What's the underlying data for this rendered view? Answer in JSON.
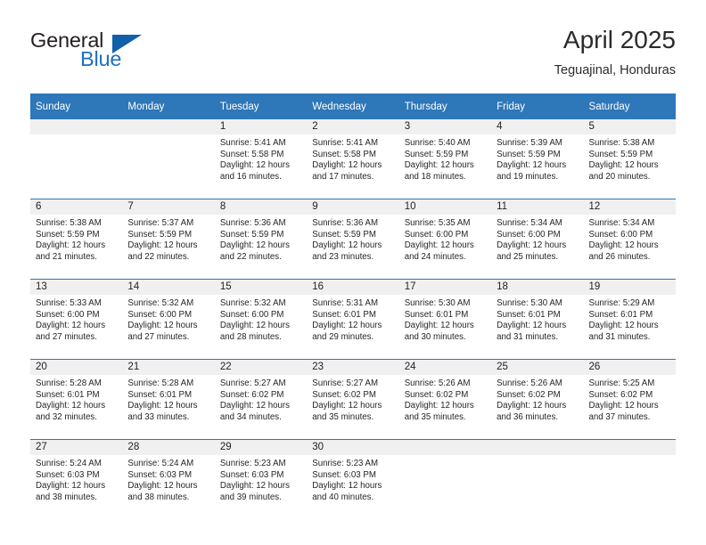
{
  "logo": {
    "word_one": "General",
    "word_two": "Blue",
    "triangle_icon": "triangle-icon"
  },
  "header": {
    "title": "April 2025",
    "location": "Teguajinal, Honduras"
  },
  "theme": {
    "header_blue": "#2e77b8",
    "band_gray": "#f0f0f0",
    "logo_blue": "#1f6ec4",
    "text": "#262626"
  },
  "weekdays": [
    "Sunday",
    "Monday",
    "Tuesday",
    "Wednesday",
    "Thursday",
    "Friday",
    "Saturday"
  ],
  "weeks": [
    [
      {
        "day": ""
      },
      {
        "day": ""
      },
      {
        "day": "1",
        "sunrise": "Sunrise: 5:41 AM",
        "sunset": "Sunset: 5:58 PM",
        "daylight1": "Daylight: 12 hours",
        "daylight2": "and 16 minutes."
      },
      {
        "day": "2",
        "sunrise": "Sunrise: 5:41 AM",
        "sunset": "Sunset: 5:58 PM",
        "daylight1": "Daylight: 12 hours",
        "daylight2": "and 17 minutes."
      },
      {
        "day": "3",
        "sunrise": "Sunrise: 5:40 AM",
        "sunset": "Sunset: 5:59 PM",
        "daylight1": "Daylight: 12 hours",
        "daylight2": "and 18 minutes."
      },
      {
        "day": "4",
        "sunrise": "Sunrise: 5:39 AM",
        "sunset": "Sunset: 5:59 PM",
        "daylight1": "Daylight: 12 hours",
        "daylight2": "and 19 minutes."
      },
      {
        "day": "5",
        "sunrise": "Sunrise: 5:38 AM",
        "sunset": "Sunset: 5:59 PM",
        "daylight1": "Daylight: 12 hours",
        "daylight2": "and 20 minutes."
      }
    ],
    [
      {
        "day": "6",
        "sunrise": "Sunrise: 5:38 AM",
        "sunset": "Sunset: 5:59 PM",
        "daylight1": "Daylight: 12 hours",
        "daylight2": "and 21 minutes."
      },
      {
        "day": "7",
        "sunrise": "Sunrise: 5:37 AM",
        "sunset": "Sunset: 5:59 PM",
        "daylight1": "Daylight: 12 hours",
        "daylight2": "and 22 minutes."
      },
      {
        "day": "8",
        "sunrise": "Sunrise: 5:36 AM",
        "sunset": "Sunset: 5:59 PM",
        "daylight1": "Daylight: 12 hours",
        "daylight2": "and 22 minutes."
      },
      {
        "day": "9",
        "sunrise": "Sunrise: 5:36 AM",
        "sunset": "Sunset: 5:59 PM",
        "daylight1": "Daylight: 12 hours",
        "daylight2": "and 23 minutes."
      },
      {
        "day": "10",
        "sunrise": "Sunrise: 5:35 AM",
        "sunset": "Sunset: 6:00 PM",
        "daylight1": "Daylight: 12 hours",
        "daylight2": "and 24 minutes."
      },
      {
        "day": "11",
        "sunrise": "Sunrise: 5:34 AM",
        "sunset": "Sunset: 6:00 PM",
        "daylight1": "Daylight: 12 hours",
        "daylight2": "and 25 minutes."
      },
      {
        "day": "12",
        "sunrise": "Sunrise: 5:34 AM",
        "sunset": "Sunset: 6:00 PM",
        "daylight1": "Daylight: 12 hours",
        "daylight2": "and 26 minutes."
      }
    ],
    [
      {
        "day": "13",
        "sunrise": "Sunrise: 5:33 AM",
        "sunset": "Sunset: 6:00 PM",
        "daylight1": "Daylight: 12 hours",
        "daylight2": "and 27 minutes."
      },
      {
        "day": "14",
        "sunrise": "Sunrise: 5:32 AM",
        "sunset": "Sunset: 6:00 PM",
        "daylight1": "Daylight: 12 hours",
        "daylight2": "and 27 minutes."
      },
      {
        "day": "15",
        "sunrise": "Sunrise: 5:32 AM",
        "sunset": "Sunset: 6:00 PM",
        "daylight1": "Daylight: 12 hours",
        "daylight2": "and 28 minutes."
      },
      {
        "day": "16",
        "sunrise": "Sunrise: 5:31 AM",
        "sunset": "Sunset: 6:01 PM",
        "daylight1": "Daylight: 12 hours",
        "daylight2": "and 29 minutes."
      },
      {
        "day": "17",
        "sunrise": "Sunrise: 5:30 AM",
        "sunset": "Sunset: 6:01 PM",
        "daylight1": "Daylight: 12 hours",
        "daylight2": "and 30 minutes."
      },
      {
        "day": "18",
        "sunrise": "Sunrise: 5:30 AM",
        "sunset": "Sunset: 6:01 PM",
        "daylight1": "Daylight: 12 hours",
        "daylight2": "and 31 minutes."
      },
      {
        "day": "19",
        "sunrise": "Sunrise: 5:29 AM",
        "sunset": "Sunset: 6:01 PM",
        "daylight1": "Daylight: 12 hours",
        "daylight2": "and 31 minutes."
      }
    ],
    [
      {
        "day": "20",
        "sunrise": "Sunrise: 5:28 AM",
        "sunset": "Sunset: 6:01 PM",
        "daylight1": "Daylight: 12 hours",
        "daylight2": "and 32 minutes."
      },
      {
        "day": "21",
        "sunrise": "Sunrise: 5:28 AM",
        "sunset": "Sunset: 6:01 PM",
        "daylight1": "Daylight: 12 hours",
        "daylight2": "and 33 minutes."
      },
      {
        "day": "22",
        "sunrise": "Sunrise: 5:27 AM",
        "sunset": "Sunset: 6:02 PM",
        "daylight1": "Daylight: 12 hours",
        "daylight2": "and 34 minutes."
      },
      {
        "day": "23",
        "sunrise": "Sunrise: 5:27 AM",
        "sunset": "Sunset: 6:02 PM",
        "daylight1": "Daylight: 12 hours",
        "daylight2": "and 35 minutes."
      },
      {
        "day": "24",
        "sunrise": "Sunrise: 5:26 AM",
        "sunset": "Sunset: 6:02 PM",
        "daylight1": "Daylight: 12 hours",
        "daylight2": "and 35 minutes."
      },
      {
        "day": "25",
        "sunrise": "Sunrise: 5:26 AM",
        "sunset": "Sunset: 6:02 PM",
        "daylight1": "Daylight: 12 hours",
        "daylight2": "and 36 minutes."
      },
      {
        "day": "26",
        "sunrise": "Sunrise: 5:25 AM",
        "sunset": "Sunset: 6:02 PM",
        "daylight1": "Daylight: 12 hours",
        "daylight2": "and 37 minutes."
      }
    ],
    [
      {
        "day": "27",
        "sunrise": "Sunrise: 5:24 AM",
        "sunset": "Sunset: 6:03 PM",
        "daylight1": "Daylight: 12 hours",
        "daylight2": "and 38 minutes."
      },
      {
        "day": "28",
        "sunrise": "Sunrise: 5:24 AM",
        "sunset": "Sunset: 6:03 PM",
        "daylight1": "Daylight: 12 hours",
        "daylight2": "and 38 minutes."
      },
      {
        "day": "29",
        "sunrise": "Sunrise: 5:23 AM",
        "sunset": "Sunset: 6:03 PM",
        "daylight1": "Daylight: 12 hours",
        "daylight2": "and 39 minutes."
      },
      {
        "day": "30",
        "sunrise": "Sunrise: 5:23 AM",
        "sunset": "Sunset: 6:03 PM",
        "daylight1": "Daylight: 12 hours",
        "daylight2": "and 40 minutes."
      },
      {
        "day": ""
      },
      {
        "day": ""
      },
      {
        "day": ""
      }
    ]
  ]
}
